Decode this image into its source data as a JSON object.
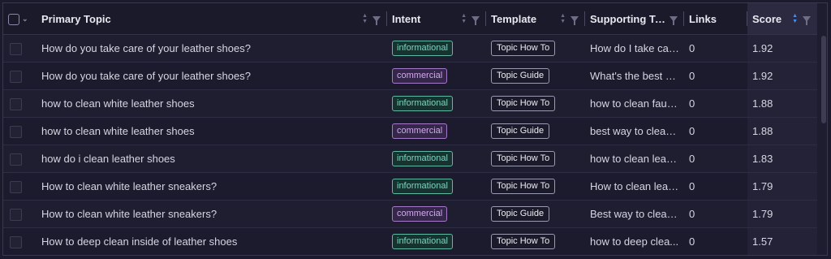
{
  "header": {
    "primary_topic": "Primary Topic",
    "intent": "Intent",
    "template": "Template",
    "supporting": "Supporting To...",
    "links": "Links",
    "score": "Score"
  },
  "rows": [
    {
      "topic": "How do you take care of your leather shoes?",
      "intent": "informational",
      "template": "Topic How To",
      "supporting": "How do I take car...",
      "links": "0",
      "score": "1.92"
    },
    {
      "topic": "How do you take care of your leather shoes?",
      "intent": "commercial",
      "template": "Topic Guide",
      "supporting": "What's the best w...",
      "links": "0",
      "score": "1.92"
    },
    {
      "topic": "how to clean white leather shoes",
      "intent": "informational",
      "template": "Topic How To",
      "supporting": "how to clean faux ...",
      "links": "0",
      "score": "1.88"
    },
    {
      "topic": "how to clean white leather shoes",
      "intent": "commercial",
      "template": "Topic Guide",
      "supporting": "best way to clean ...",
      "links": "0",
      "score": "1.88"
    },
    {
      "topic": "how do i clean leather shoes",
      "intent": "informational",
      "template": "Topic How To",
      "supporting": "how to clean leath...",
      "links": "0",
      "score": "1.83"
    },
    {
      "topic": "How to clean white leather sneakers?",
      "intent": "informational",
      "template": "Topic How To",
      "supporting": "How to clean leat...",
      "links": "0",
      "score": "1.79"
    },
    {
      "topic": "How to clean white leather sneakers?",
      "intent": "commercial",
      "template": "Topic Guide",
      "supporting": "Best way to clean ...",
      "links": "0",
      "score": "1.79"
    },
    {
      "topic": "How to deep clean inside of leather shoes",
      "intent": "informational",
      "template": "Topic How To",
      "supporting": "how to deep clea...",
      "links": "0",
      "score": "1.57"
    }
  ],
  "colors": {
    "informational": "#7fd3c0",
    "commercial": "#d3a8f0",
    "sort_active": "#4f8be8"
  },
  "icons": {
    "sort": "sort-icon",
    "filter": "filter-icon",
    "checkbox": "checkbox-icon"
  }
}
